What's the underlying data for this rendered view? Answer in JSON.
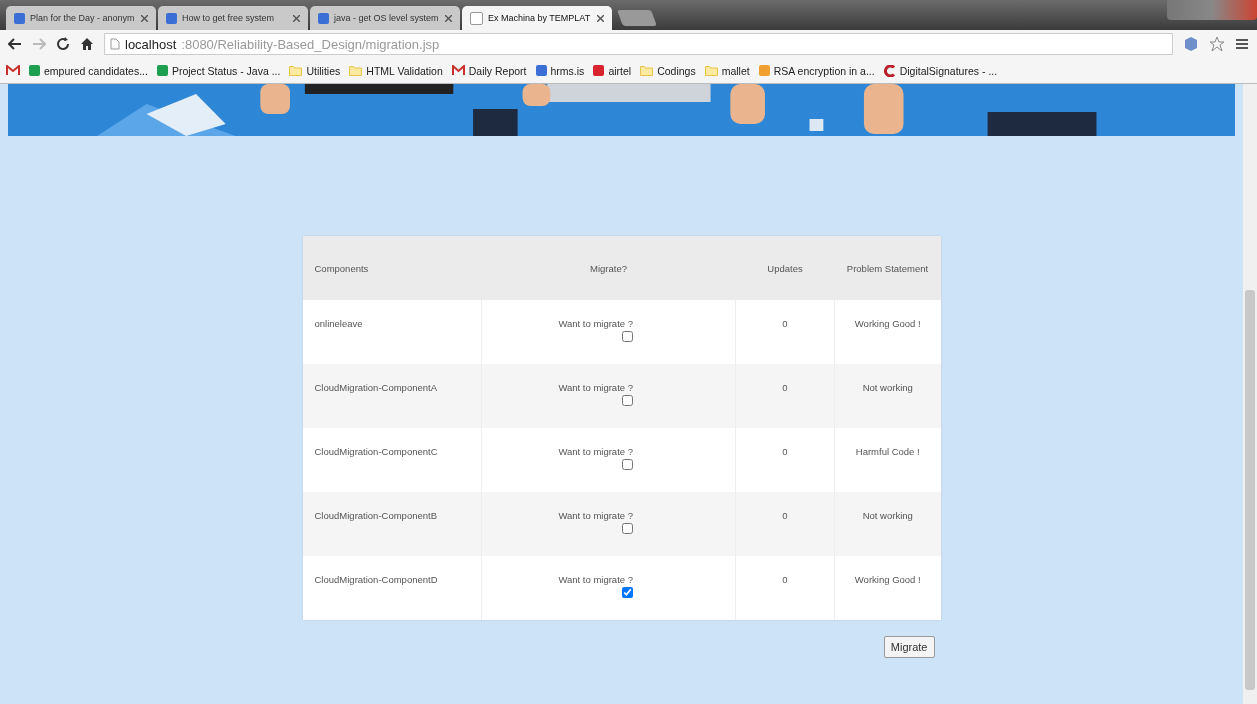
{
  "tabs": [
    {
      "title": "Plan for the Day - anonym",
      "selected": false
    },
    {
      "title": "How to get free system",
      "selected": false
    },
    {
      "title": "java - get OS level system",
      "selected": false
    },
    {
      "title": "Ex Machina by TEMPLAT",
      "selected": true
    }
  ],
  "address": {
    "host": "localhost",
    "path": ":8080/Reliability-Based_Design/migration.jsp"
  },
  "bookmarks": [
    {
      "label": "empured candidates...",
      "kind": "sheet"
    },
    {
      "label": "Project Status - Java ...",
      "kind": "sheet"
    },
    {
      "label": "Utilities",
      "kind": "folder"
    },
    {
      "label": "HTML Validation",
      "kind": "folder"
    },
    {
      "label": "Daily Report",
      "kind": "mail"
    },
    {
      "label": "hrms.is",
      "kind": "doc"
    },
    {
      "label": "airtel",
      "kind": "airtel"
    },
    {
      "label": "Codings",
      "kind": "folder"
    },
    {
      "label": "mallet",
      "kind": "folder"
    },
    {
      "label": "RSA encryption in a...",
      "kind": "page"
    },
    {
      "label": "DigitalSignatures - ...",
      "kind": "c"
    }
  ],
  "table": {
    "columns": [
      "Components",
      "Migrate?",
      "Updates",
      "Problem Statement"
    ],
    "rows": [
      {
        "component": "onlineleave",
        "prompt": "Want to migrate ?",
        "checked": false,
        "updates": "0",
        "problem": "Working Good !"
      },
      {
        "component": "CloudMigration-ComponentA",
        "prompt": "Want to migrate ?",
        "checked": false,
        "updates": "0",
        "problem": "Not working"
      },
      {
        "component": "CloudMigration-ComponentC",
        "prompt": "Want to migrate ?",
        "checked": false,
        "updates": "0",
        "problem": "Harmful Code !"
      },
      {
        "component": "CloudMigration-ComponentB",
        "prompt": "Want to migrate ?",
        "checked": false,
        "updates": "0",
        "problem": "Not working"
      },
      {
        "component": "CloudMigration-ComponentD",
        "prompt": "Want to migrate ?",
        "checked": true,
        "updates": "0",
        "problem": "Working Good !"
      }
    ]
  },
  "migrate_button": "Migrate"
}
